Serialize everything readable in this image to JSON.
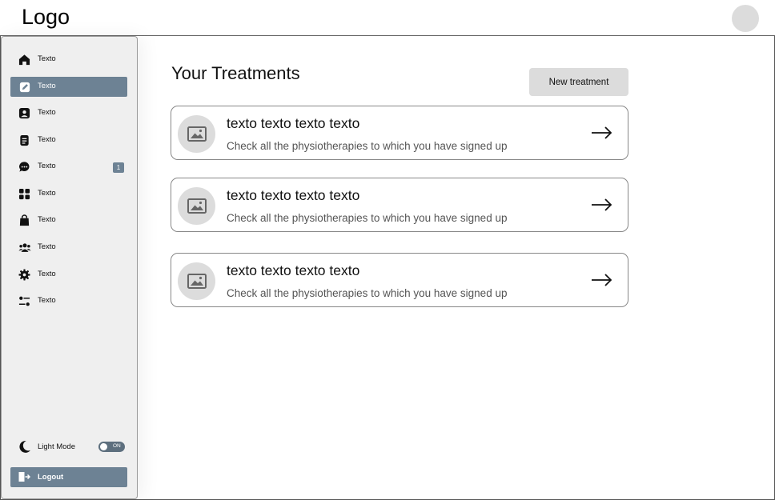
{
  "header": {
    "logo": "Logo"
  },
  "sidebar": {
    "items": [
      {
        "label": "Texto",
        "icon": "home-icon",
        "active": false
      },
      {
        "label": "Texto",
        "icon": "edit-icon",
        "active": true
      },
      {
        "label": "Texto",
        "icon": "profile-card-icon",
        "active": false
      },
      {
        "label": "Texto",
        "icon": "document-icon",
        "active": false
      },
      {
        "label": "Texto",
        "icon": "chat-icon",
        "active": false,
        "badge": "1"
      },
      {
        "label": "Texto",
        "icon": "grid-icon",
        "active": false
      },
      {
        "label": "Texto",
        "icon": "bag-icon",
        "active": false
      },
      {
        "label": "Texto",
        "icon": "users-icon",
        "active": false
      },
      {
        "label": "Texto",
        "icon": "gear-icon",
        "active": false
      },
      {
        "label": "Texto",
        "icon": "sliders-icon",
        "active": false
      }
    ],
    "light_mode": {
      "label": "Light Mode",
      "toggle_text": "ON"
    },
    "logout": {
      "label": "Logout"
    }
  },
  "main": {
    "title": "Your Treatments",
    "new_button": "New treatment",
    "cards": [
      {
        "title": "texto texto texto texto",
        "description": "Check all the physiotherapies to which you have signed up"
      },
      {
        "title": "texto texto texto texto",
        "description": "Check all the physiotherapies to which you have signed up"
      },
      {
        "title": "texto texto texto texto",
        "description": "Check all the physiotherapies to which you have signed up"
      }
    ]
  },
  "colors": {
    "accent": "#6d8294",
    "sidebar_bg": "#efefef",
    "placeholder_gray": "#dcdcdc"
  }
}
